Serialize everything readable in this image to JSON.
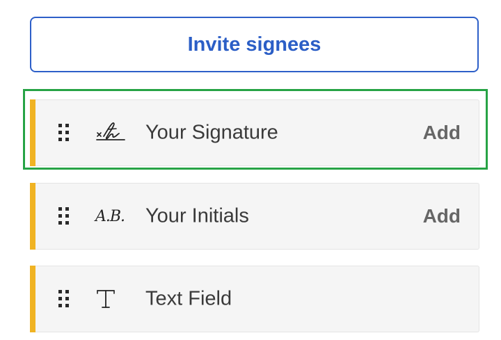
{
  "invite": {
    "label": "Invite signees"
  },
  "fields": [
    {
      "label": "Your Signature",
      "icon": "signature-icon",
      "action": "Add"
    },
    {
      "label": "Your Initials",
      "icon": "initials-icon",
      "icon_text": "A.B.",
      "action": "Add"
    },
    {
      "label": "Text Field",
      "icon": "text-field-icon"
    }
  ],
  "colors": {
    "accent_bar": "#f0b323",
    "invite_text": "#2b5ec6",
    "selection_outline": "#27a345",
    "row_background": "#f5f5f5"
  }
}
